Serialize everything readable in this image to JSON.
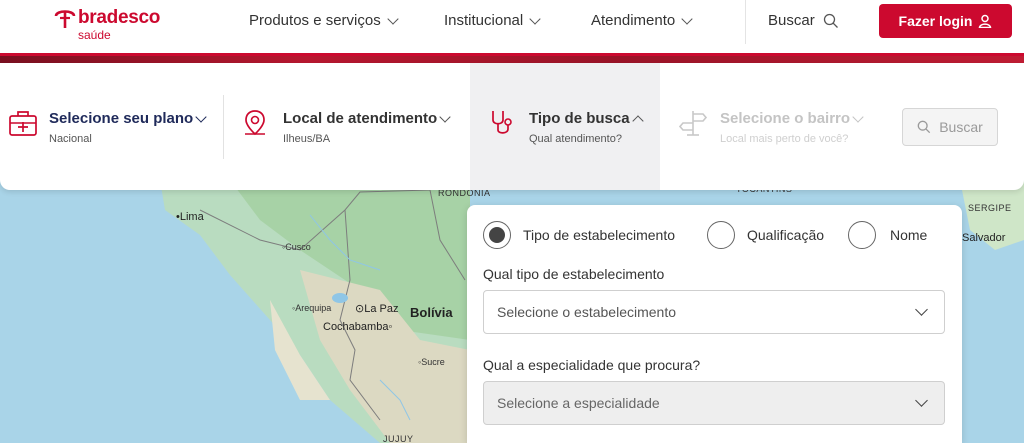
{
  "header": {
    "logo_word": "bradesco",
    "logo_sub": "saúde",
    "nav": [
      "Produtos e serviços",
      "Institucional",
      "Atendimento"
    ],
    "search_label": "Buscar",
    "login_label": "Fazer login"
  },
  "filters": {
    "plan": {
      "title": "Selecione seu plano",
      "sub": "Nacional"
    },
    "location": {
      "title": "Local de atendimento",
      "sub": "Ilheus/BA"
    },
    "search_type": {
      "title": "Tipo de busca",
      "sub": "Qual atendimento?"
    },
    "district": {
      "title": "Selecione o bairro",
      "sub": "Local mais perto de você?"
    },
    "search_button": "Buscar"
  },
  "panel": {
    "radios": [
      {
        "label": "Tipo de estabelecimento",
        "checked": true
      },
      {
        "label": "Qualificação",
        "checked": false
      },
      {
        "label": "Nome",
        "checked": false
      }
    ],
    "establishment_label": "Qual tipo de estabelecimento",
    "establishment_placeholder": "Selecione o estabelecimento",
    "specialty_label": "Qual a especialidade que procura?",
    "specialty_placeholder": "Selecione a especialidade"
  },
  "map": {
    "labels": [
      "RONDÔNIA",
      "TOCANTINS",
      "SERGIPE",
      "Salvador",
      "Lima",
      "Cusco",
      "Arequipa",
      "La Paz",
      "Bolívia",
      "Cochabamba",
      "Sucre",
      "JUJUY"
    ]
  },
  "colors": {
    "brand": "#cc092f",
    "title": "#1f2a5a",
    "active_bg": "#f0f0f2"
  }
}
